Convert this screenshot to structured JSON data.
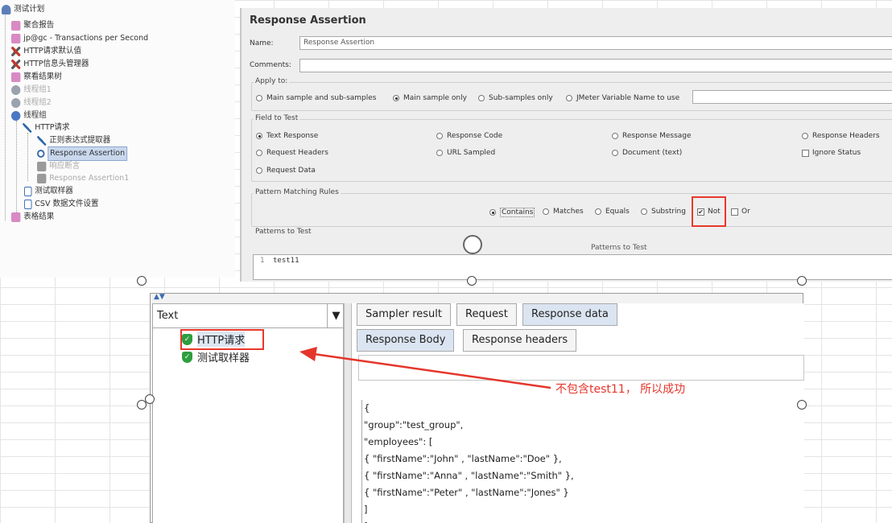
{
  "tree": {
    "items": [
      {
        "label": "测试计划",
        "icon": "test-plan-icon",
        "dim": false
      },
      {
        "label": "聚合报告",
        "icon": "report-icon",
        "dim": false
      },
      {
        "label": "jp@gc - Transactions per Second",
        "icon": "graph-icon",
        "dim": false
      },
      {
        "label": "HTTP请求默认值",
        "icon": "wrench-icon",
        "dim": false
      },
      {
        "label": "HTTP信息头管理器",
        "icon": "wrench-icon",
        "dim": false
      },
      {
        "label": "察看结果树",
        "icon": "report-icon",
        "dim": false
      },
      {
        "label": "线程组1",
        "icon": "thread-group-icon",
        "dim": true
      },
      {
        "label": "线程组2",
        "icon": "thread-group-icon",
        "dim": true
      },
      {
        "label": "线程组",
        "icon": "thread-group-icon",
        "dim": false
      },
      {
        "label": "HTTP请求",
        "icon": "sampler-icon",
        "dim": false
      },
      {
        "label": "正则表达式提取器",
        "icon": "extractor-icon",
        "dim": false
      },
      {
        "label": "Response Assertion",
        "icon": "assertion-icon",
        "dim": false,
        "selected": true
      },
      {
        "label": "响应断言",
        "icon": "assertion-icon",
        "dim": true
      },
      {
        "label": "Response Assertion1",
        "icon": "assertion-icon",
        "dim": true
      },
      {
        "label": "测试取样器",
        "icon": "document-icon",
        "dim": false
      },
      {
        "label": "CSV 数据文件设置",
        "icon": "document-icon",
        "dim": false
      },
      {
        "label": "表格结果",
        "icon": "report-icon",
        "dim": false
      }
    ]
  },
  "assertion": {
    "title": "Response Assertion",
    "name_label": "Name:",
    "name_value": "Response Assertion",
    "comments_label": "Comments:",
    "apply_to": {
      "title": "Apply to:",
      "options": [
        "Main sample and sub-samples",
        "Main sample only",
        "Sub-samples only",
        "JMeter Variable Name to use"
      ],
      "selected": "Main sample only"
    },
    "field_to_test": {
      "title": "Field to Test",
      "options": [
        "Text Response",
        "Response Code",
        "Response Message",
        "Response Headers",
        "Request Headers",
        "URL Sampled",
        "Document (text)",
        "Request Data"
      ],
      "ignore_status": "Ignore Status",
      "selected": "Text Response"
    },
    "pattern_matching": {
      "title": "Pattern Matching Rules",
      "options": [
        "Contains",
        "Matches",
        "Equals",
        "Substring"
      ],
      "selected": "Contains",
      "not_label": "Not",
      "not_checked": true,
      "or_label": "Or",
      "or_checked": false
    },
    "patterns": {
      "title": "Patterns to Test",
      "header": "Patterns to Test",
      "line_number": "1",
      "value": "test11"
    }
  },
  "results": {
    "renderer": "Text",
    "tree_items": [
      "HTTP请求",
      "测试取样器"
    ],
    "tabs": [
      "Sampler result",
      "Request",
      "Response data"
    ],
    "active_tab": "Response data",
    "subtabs": [
      "Response Body",
      "Response headers"
    ],
    "active_subtab": "Response Body",
    "body_lines": [
      "{",
      "\"group\":\"test_group\",",
      "\"employees\": [",
      "{ \"firstName\":\"John\" , \"lastName\":\"Doe\" },",
      "{ \"firstName\":\"Anna\" , \"lastName\":\"Smith\" },",
      "{ \"firstName\":\"Peter\" , \"lastName\":\"Jones\" }",
      "]",
      "}"
    ]
  },
  "annotation": "不包含test11， 所以成功",
  "colors": {
    "highlight_red": "#e8382c",
    "success_green": "#2e9e3e",
    "selection_blue": "#c9d8ee"
  }
}
